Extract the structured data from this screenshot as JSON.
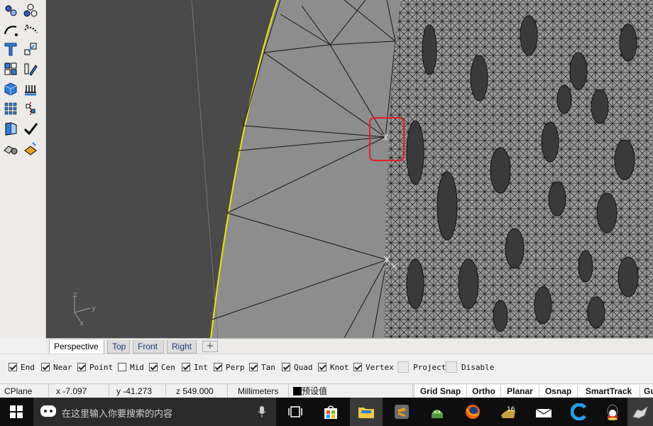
{
  "view_tabs": [
    "Perspective",
    "Top",
    "Front",
    "Right"
  ],
  "snaps": [
    {
      "label": "End",
      "checked": true
    },
    {
      "label": "Near",
      "checked": true
    },
    {
      "label": "Point",
      "checked": true
    },
    {
      "label": "Mid",
      "checked": false
    },
    {
      "label": "Cen",
      "checked": true
    },
    {
      "label": "Int",
      "checked": true
    },
    {
      "label": "Perp",
      "checked": true
    },
    {
      "label": "Tan",
      "checked": true
    },
    {
      "label": "Quad",
      "checked": true
    },
    {
      "label": "Knot",
      "checked": true
    },
    {
      "label": "Vertex",
      "checked": true
    },
    {
      "label": "Project",
      "checked": false
    },
    {
      "label": "Disable",
      "checked": false
    }
  ],
  "status": {
    "cplane": "CPlane",
    "x": "x -7.097",
    "y": "y -41.273",
    "z": "z 549.000",
    "units": "Millimeters",
    "layer": "预设值",
    "buttons": [
      "Grid Snap",
      "Ortho",
      "Planar",
      "Osnap",
      "SmartTrack",
      "Gu"
    ]
  },
  "axes": {
    "z": "z",
    "y": "y",
    "x": "x"
  },
  "taskbar": {
    "search_placeholder": "在这里输入你要搜索的内容",
    "calendar_day": "16"
  },
  "colors": {
    "viewport_bg": "#4a4a4a",
    "surface": "#8c8c8c",
    "highlight": "#e02020",
    "edge": "#e8e800"
  }
}
